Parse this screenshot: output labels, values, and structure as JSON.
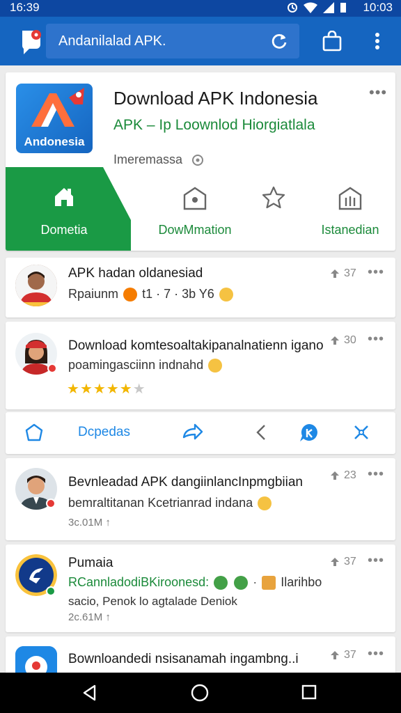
{
  "status_bar": {
    "time_left": "16:39",
    "time_right": "10:03"
  },
  "app_bar": {
    "search_text": "Andanilalad APK.",
    "icons": [
      "app-logo-icon",
      "refresh-icon",
      "shopping-bag-icon",
      "more-vert-icon"
    ]
  },
  "app_card": {
    "icon_label": "Andonesia",
    "title": "Download APK Indonesia",
    "subtitle": "APK – Ip Loownlod Hiorgiatlala",
    "meta": "Imeremassa",
    "tabs": [
      {
        "label": "Dometia",
        "icon": "home-icon"
      },
      {
        "label": "DowMmation",
        "icon": "download-house-icon"
      },
      {
        "label": "",
        "icon": "star-icon"
      },
      {
        "label": "Istanedian",
        "icon": "install-icon"
      }
    ]
  },
  "posts": [
    {
      "title": "APK hadan oldanesiad",
      "line1": "Rpaiunm",
      "line1_extra": "t1 · 7 · 3b Y6",
      "count": "37"
    },
    {
      "title": "Download komtesoaltakipanalnatienn igano",
      "line1": "poamingasciinn indnahd",
      "rating": 4.5,
      "count": "30"
    },
    {
      "title": "Bevnleadad APK dangiinlancInpmgbiian",
      "line1": "bemraltitanan Kcetrianrad indana",
      "small": "3c.01M ↑",
      "count": "23"
    },
    {
      "title": "Pumaia",
      "line1": "RCannladodiBKiroonesd:",
      "line1_extra": "Ilarihbo",
      "line2": "sacio, Penok lo agtalade Deniok",
      "small": "2c.61M ↑",
      "count": "37"
    },
    {
      "title": "Bownloandedi nsisanamah ingambng..i",
      "count": "37"
    }
  ],
  "action_bar": {
    "label": "Dcpedas"
  },
  "colors": {
    "app_bar": "#1565c0",
    "status_bar": "#0d47a1",
    "accent_green": "#1a9a45",
    "link_blue": "#1e88e5"
  }
}
